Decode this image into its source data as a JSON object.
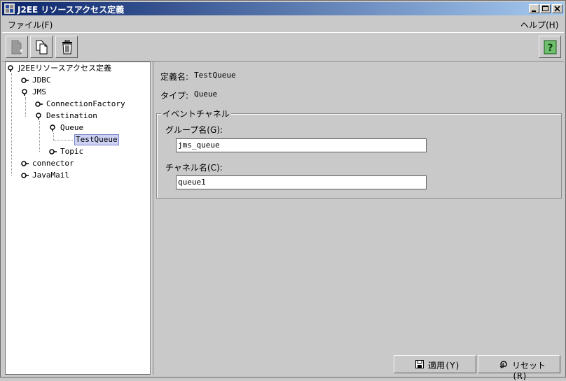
{
  "window": {
    "title": "J2EE リソースアクセス定義"
  },
  "menu": {
    "file": "ファイル(F)",
    "help": "ヘルプ(H)"
  },
  "toolbar": {
    "buttons": [
      {
        "icon": "new-document-icon"
      },
      {
        "icon": "copy-icon"
      },
      {
        "icon": "trash-icon"
      }
    ],
    "help_button": {
      "icon": "help-icon",
      "glyph": "?"
    }
  },
  "tree": {
    "root": "J2EEリソースアクセス定義",
    "items": {
      "jdbc": "JDBC",
      "jms": "JMS",
      "connection_factory": "ConnectionFactory",
      "destination": "Destination",
      "queue": "Queue",
      "test_queue": "TestQueue",
      "topic": "Topic",
      "connector": "connector",
      "javamail": "JavaMail"
    }
  },
  "detail": {
    "definition_label": "定義名:",
    "definition_value": "TestQueue",
    "type_label": "タイプ:",
    "type_value": "Queue",
    "group_title": "イベントチャネル",
    "group_name_label": "グループ名(G):",
    "group_name_value": "jms_queue",
    "channel_name_label": "チャネル名(C):",
    "channel_name_value": "queue1"
  },
  "buttons": {
    "apply": "適用(Y)",
    "reset": "リセット(R)"
  }
}
